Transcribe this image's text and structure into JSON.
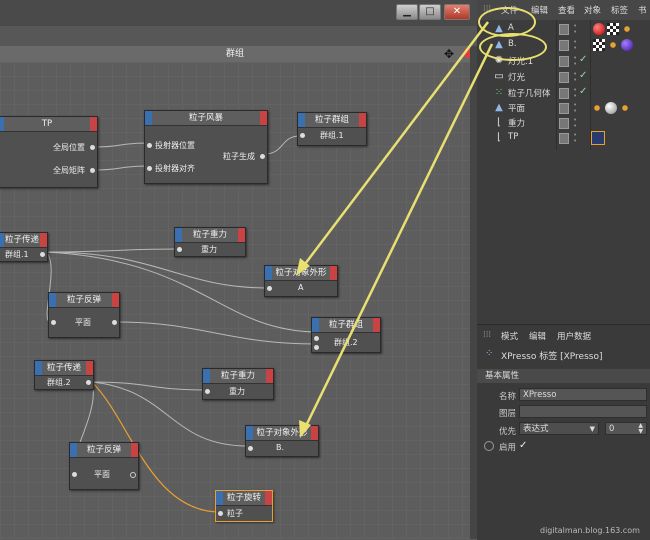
{
  "editor": {
    "group_title": "群组",
    "nodes": {
      "tp": {
        "title": "TP",
        "out1": "全局位置",
        "out2": "全局矩阵"
      },
      "storm": {
        "title": "粒子风暴",
        "in1": "投射器位置",
        "in2": "投射器对齐",
        "out1": "粒子生成"
      },
      "group_top": {
        "title": "粒子群组",
        "port": "群组.1"
      },
      "pass1": {
        "title": "粒子传递",
        "port": "群组.1"
      },
      "gravity1": {
        "title": "粒子重力",
        "port": "重力"
      },
      "shape_a": {
        "title": "粒子对象外形",
        "port": "A"
      },
      "bounce1": {
        "title": "粒子反弹",
        "port": "平面"
      },
      "group2": {
        "title": "粒子群组",
        "port": "群组.2"
      },
      "pass2": {
        "title": "粒子传递",
        "port": "群组.2"
      },
      "gravity2": {
        "title": "粒子重力",
        "port": "重力"
      },
      "shape_b": {
        "title": "粒子对象外形",
        "port": "B."
      },
      "bounce2": {
        "title": "粒子反弹",
        "port": "平面"
      },
      "spin": {
        "title": "粒子旋转",
        "port": "粒子"
      }
    }
  },
  "object_manager": {
    "menu": [
      "文件",
      "编辑",
      "查看",
      "对象",
      "标签",
      "书"
    ],
    "objects": [
      {
        "name": "A",
        "icon": "cone-icon"
      },
      {
        "name": "B.",
        "icon": "cone-icon"
      },
      {
        "name": "灯光.1",
        "icon": "light-icon"
      },
      {
        "name": "灯光",
        "icon": "light-icon"
      },
      {
        "name": "粒子几何体",
        "icon": "particle-geometry-icon"
      },
      {
        "name": "平面",
        "icon": "plane-icon"
      },
      {
        "name": "重力",
        "icon": "gravity-icon"
      },
      {
        "name": "TP",
        "icon": "null-icon"
      }
    ]
  },
  "attributes": {
    "menu": [
      "模式",
      "编辑",
      "用户数据"
    ],
    "title": "XPresso 标签 [XPresso]",
    "section": "基本属性",
    "name_label": "名称",
    "name_value": "XPresso",
    "layer_label": "图层",
    "priority_label": "优先",
    "priority_value": "表达式",
    "priority_number": "0",
    "enable_label": "启用",
    "enable_check": "✓"
  },
  "watermark": "digitalman.blog.163.com",
  "colors": {
    "annotation": "#e8e070",
    "node_header_left": "#3a6fb0",
    "node_header_right": "#c84444"
  }
}
